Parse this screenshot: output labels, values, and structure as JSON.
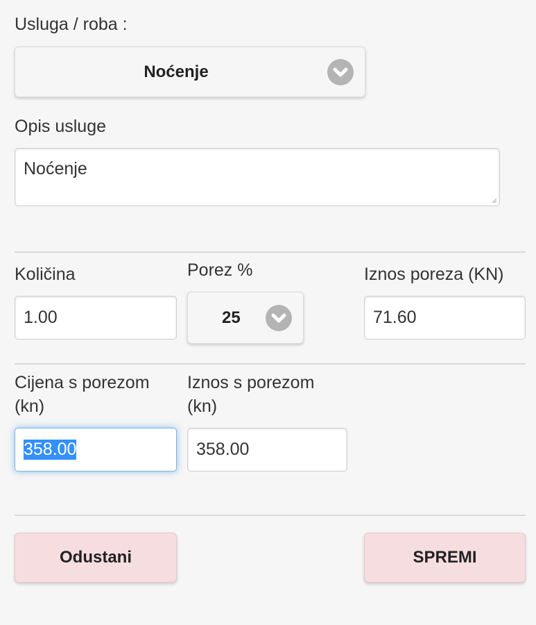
{
  "service_section": {
    "label": "Usluga / roba :",
    "select_value": "Noćenje",
    "chevron_icon": "chevron-down-icon"
  },
  "description": {
    "label": "Opis usluge",
    "value": "Noćenje"
  },
  "quantity": {
    "label": "Količina",
    "value": "1.00"
  },
  "tax_rate": {
    "label": "Porez %",
    "select_value": "25"
  },
  "tax_amount": {
    "label": "Iznos poreza (KN)",
    "value": "71.60"
  },
  "price_with_tax": {
    "label_line1": "Cijena s porezom",
    "label_line2": "(kn)",
    "value": "358.00"
  },
  "amount_with_tax": {
    "label_line1": "Iznos s porezom",
    "label_line2": "(kn)",
    "value": "358.00"
  },
  "actions": {
    "cancel_label": "Odustani",
    "save_label": "SPREMI"
  },
  "colors": {
    "background": "#f6f6f6",
    "button_bg": "#f6dde0",
    "chevron_bg": "#b4b4b4",
    "focus_glow": "#388cdc",
    "selection": "#3390ff"
  }
}
